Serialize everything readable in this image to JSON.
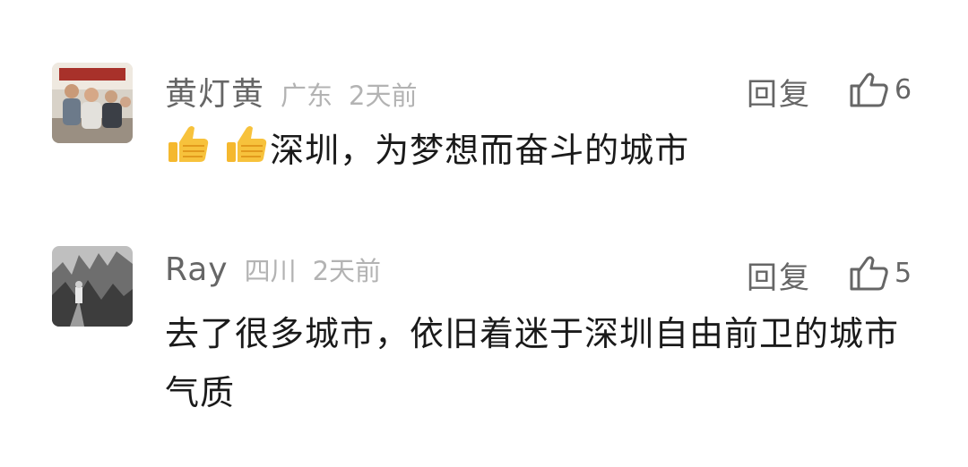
{
  "comments": [
    {
      "author": "黄灯黄",
      "region": "广东",
      "time": "2天前",
      "reply_label": "回复",
      "likes": "6",
      "emojis": [
        "thumbs-up-icon",
        "thumbs-up-icon"
      ],
      "text": "深圳，为梦想而奋斗的城市"
    },
    {
      "author": "Ray",
      "region": "四川",
      "time": "2天前",
      "reply_label": "回复",
      "likes": "5",
      "text": "去了很多城市，依旧着迷于深圳自由前卫的城市气质"
    }
  ],
  "colors": {
    "name": "#666666",
    "meta": "#b3b3b3",
    "body_text": "#1a1a1a",
    "emoji": "#f5b82e"
  }
}
